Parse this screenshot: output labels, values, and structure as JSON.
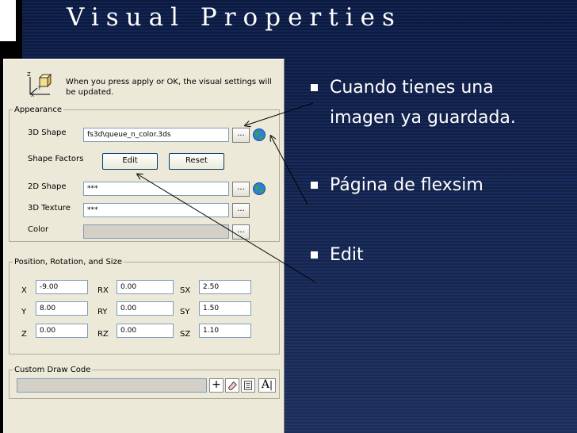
{
  "slide": {
    "title": "Visual Properties",
    "bullets": [
      "Cuando tienes una imagen ya guardada.",
      "Página de flexsim",
      "Edit"
    ]
  },
  "dialog": {
    "info_text": "When you press apply or OK, the visual settings will be updated.",
    "axis_labels": {
      "z": "Z",
      "y": "Y",
      "x": "X"
    },
    "appearance": {
      "legend": "Appearance",
      "shape_label": "3D Shape",
      "shape_value": "fs3d\\queue_n_color.3ds",
      "shape_factors_label": "Shape Factors",
      "edit_label": "Edit",
      "reset_label": "Reset",
      "shape2d_label": "2D Shape",
      "shape2d_value": "***",
      "texture_label": "3D Texture",
      "texture_value": "***",
      "color_label": "Color",
      "browse_label": "..."
    },
    "position": {
      "legend": "Position, Rotation, and Size",
      "x_label": "X",
      "x_value": "-9.00",
      "y_label": "Y",
      "y_value": "8.00",
      "z_label": "Z",
      "z_value": "0.00",
      "rx_label": "RX",
      "rx_value": "0.00",
      "ry_label": "RY",
      "ry_value": "0.00",
      "rz_label": "RZ",
      "rz_value": "0.00",
      "sx_label": "SX",
      "sx_value": "2.50",
      "sy_label": "SY",
      "sy_value": "1.50",
      "sz_label": "SZ",
      "sz_value": "1.10"
    },
    "custom_draw": {
      "legend": "Custom Draw Code",
      "add_label": "+",
      "font_label": "A"
    }
  },
  "colors": {
    "background": "#0b1a3e",
    "dialog": "#ece9d8",
    "text": "#ffffff"
  }
}
